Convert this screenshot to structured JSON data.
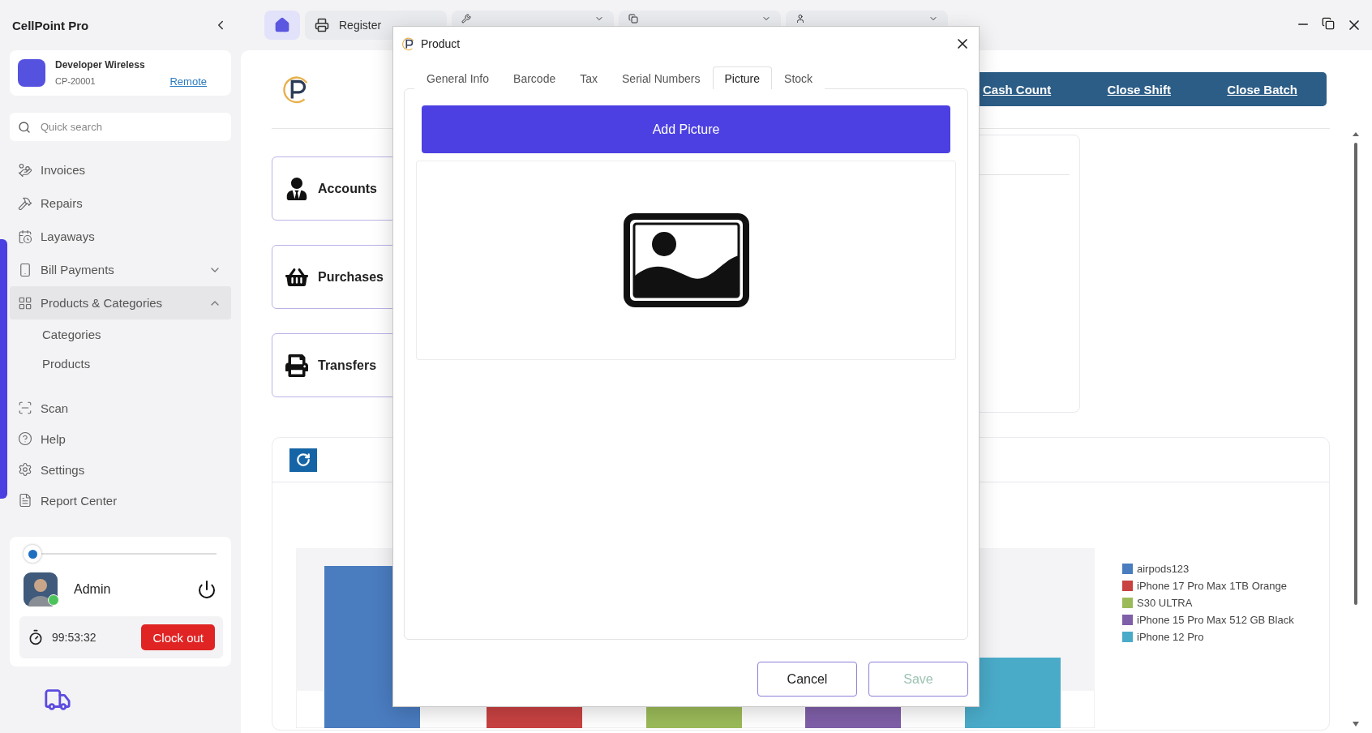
{
  "app": {
    "title": "CellPoint Pro"
  },
  "account": {
    "name": "Developer Wireless",
    "code": "CP-20001",
    "link": "Remote"
  },
  "search": {
    "placeholder": "Quick search"
  },
  "nav": [
    {
      "label": "Invoices",
      "selected": false
    },
    {
      "label": "Repairs",
      "selected": false
    },
    {
      "label": "Layaways",
      "selected": false
    },
    {
      "label": "Bill Payments",
      "selected": false,
      "expanded": false
    },
    {
      "label": "Products & Categories",
      "selected": true,
      "expanded": true,
      "children": [
        {
          "label": "Categories",
          "selected": false
        },
        {
          "label": "Products",
          "selected": false
        }
      ]
    },
    {
      "label": "Scan",
      "selected": false
    },
    {
      "label": "Help",
      "selected": false
    },
    {
      "label": "Settings",
      "selected": false
    },
    {
      "label": "Report Center",
      "selected": false
    }
  ],
  "user": {
    "name": "Admin",
    "online": true,
    "level": 0,
    "timer": "99:53:32",
    "clock_out": "Clock out"
  },
  "top_tabs": [
    {
      "kind": "home",
      "selected": true
    },
    {
      "kind": "register",
      "label": "Register",
      "selected": false
    },
    {
      "kind": "repairs",
      "selected": false
    },
    {
      "kind": "products",
      "selected": false
    },
    {
      "kind": "customers",
      "selected": false
    }
  ],
  "main": {
    "actions": [
      "Cash Count",
      "Close Shift",
      "Close Batch"
    ],
    "tiles": [
      "Accounts",
      "Purchases",
      "Transfers"
    ],
    "chart": {
      "legend": [
        {
          "label": "airpods123",
          "color": "#4a7cc0"
        },
        {
          "label": "iPhone 17 Pro Max 1TB Orange",
          "color": "#c94242"
        },
        {
          "label": "S30 ULTRA",
          "color": "#9bbb59"
        },
        {
          "label": "iPhone 15 Pro Max 512 GB Black",
          "color": "#7f5fa8"
        },
        {
          "label": "iPhone 12 Pro",
          "color": "#4aabc9"
        }
      ]
    }
  },
  "dialog": {
    "title": "Product",
    "tabs": [
      {
        "label": "General Info",
        "selected": false
      },
      {
        "label": "Barcode",
        "selected": false
      },
      {
        "label": "Tax",
        "selected": false
      },
      {
        "label": "Serial Numbers",
        "selected": false
      },
      {
        "label": "Picture",
        "selected": true
      },
      {
        "label": "Stock",
        "selected": false
      }
    ],
    "add_button": "Add Picture",
    "cancel": "Cancel",
    "save": "Save",
    "save_disabled": true
  }
}
